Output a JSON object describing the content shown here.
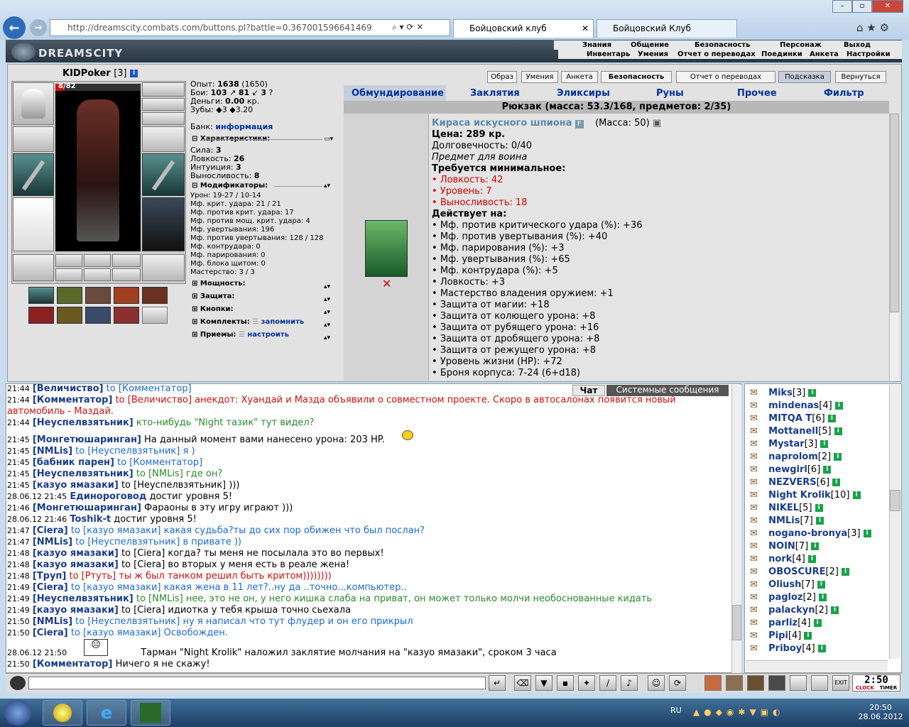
{
  "browser": {
    "url": "http://dreamscity.combats.com/buttons.pl?battle=0.367001596641469",
    "tabs": [
      "Бойцовский клуб",
      "Бойцовский Клуб"
    ],
    "win_buttons": [
      "–",
      "▫",
      "✕"
    ]
  },
  "game": {
    "logo": "DREAMSCITY",
    "menu_row1": [
      "Знания",
      "Общение",
      "Безопасность",
      "Персонаж",
      "Выход"
    ],
    "menu_row2": [
      "Инвентарь",
      "Умения",
      "Отчет о переводах",
      "Поединки",
      "Анкета",
      "Настройки"
    ]
  },
  "character": {
    "name": "KIDPoker",
    "level": "[3]",
    "hp": "8/82",
    "stats_top": [
      {
        "label": "Опыт:",
        "value": "1638",
        "extra": "(1650)"
      },
      {
        "label": "Бои:",
        "value": "103",
        "extra": "81",
        "extra2": "3"
      },
      {
        "label": "Деньги:",
        "value": "0.00",
        "extra": "кр."
      },
      {
        "label": "Зубы:",
        "value": "3",
        "extra": "3.20"
      }
    ],
    "bank_label": "Банк:",
    "bank_link": "информация",
    "characteristics_title": "Характеристики:",
    "characteristics": [
      {
        "label": "Сила:",
        "value": "3"
      },
      {
        "label": "Ловкость:",
        "value": "26"
      },
      {
        "label": "Интуиция:",
        "value": "3"
      },
      {
        "label": "Выносливость:",
        "value": "8"
      }
    ],
    "modifiers_title": "Модификаторы:",
    "modifiers": [
      "Урон: 19-27 / 10-14",
      "Мф. крит. удара: 21 / 21",
      "Мф. против крит. удара: 17",
      "Мф. против мощ. крит. удара: 4",
      "Мф. увертывания: 196",
      "Мф. против увертывания: 128 / 128",
      "Мф. контрудара: 0",
      "Мф. парирования: 0",
      "Мф. блока щитом: 0",
      "Мастерство: 3 / 3"
    ],
    "sections": [
      {
        "title": "Мощность:",
        "link": ""
      },
      {
        "title": "Защита:",
        "link": ""
      },
      {
        "title": "Кнопки:",
        "link": ""
      },
      {
        "title": "Комплекты:",
        "link": "запомнить"
      },
      {
        "title": "Приемы:",
        "link": "настроить"
      }
    ]
  },
  "top_buttons": [
    "Образ",
    "Умения",
    "Анкета",
    "Безопасность",
    "Отчет о переводах",
    "Подсказка",
    "Вернуться"
  ],
  "inventory": {
    "tabs": [
      "Обмундирование",
      "Заклятия",
      "Эликсиры",
      "Руны",
      "Прочее",
      "Фильтр"
    ],
    "backpack_title": "Рюкзак (масса: 53.3/168, предметов: 2/35)",
    "item": {
      "name": "Кираса искусного шпиона",
      "mass": "(Масса: 50)",
      "price": "Цена: 289 кр.",
      "durability": "Долговечность: 0/40",
      "for_class": "Предмет для воина",
      "req_title": "Требуется минимальное:",
      "requirements": [
        "Ловкость: 42",
        "Уровень: 7",
        "Выносливость: 18"
      ],
      "effects_title": "Действует на:",
      "effects": [
        "Мф. против критического удара (%): +36",
        "Мф. против увертывания (%): +40",
        "Мф. парирования (%): +3",
        "Мф. увертывания (%): +65",
        "Мф. контрудара (%): +5",
        "Ловкость: +3",
        "Мастерство владения оружием: +1",
        "Защита от магии: +18",
        "Защита от колющего урона: +8",
        "Защита от рубящего урона: +16",
        "Защита от дробящего урона: +8",
        "Защита от режущего урона: +8",
        "Уровень жизни (HP): +72",
        "Броня корпуса: 7-24 (6+d18)"
      ]
    }
  },
  "chat": {
    "tabs": [
      "Чат",
      "Системные сообщения"
    ],
    "lines": [
      {
        "time": "21:44",
        "nick": "[Величиство]",
        "to": "to [Комментатор]",
        "msg": "",
        "color": "#1a6ad8"
      },
      {
        "time": "21:44",
        "nick": "[Комментатор]",
        "to": "to [Величиство]",
        "msg": "анекдот: Хуандай и Мазда объявили о совместном проекте. Скоро в автосалонах появится новый",
        "color": "#d01010"
      },
      {
        "time": "",
        "nick": "",
        "to": "",
        "msg": "автомобиль - Маздай.",
        "color": "#d01010"
      },
      {
        "time": "21:44",
        "nick": "[Неуспелвзятьник]",
        "to": "",
        "msg": "кто-нибудь \"Night тазик\" тут видел?",
        "color": "#2a8a2a"
      },
      {
        "time": "21:45",
        "nick": "[Монгетюшаринган]",
        "to": "",
        "msg": "На данный момент вами нанесено урона: 203 HP.",
        "color": "#000000"
      },
      {
        "time": "21:45",
        "nick": "[NMLis]",
        "to": "to [Неуспелвзятьник]",
        "msg": "я )",
        "color": "#1a6ad8"
      },
      {
        "time": "21:45",
        "nick": "[бабник парен]",
        "to": "to [Комментатор]",
        "msg": "",
        "color": "#1a6ad8"
      },
      {
        "time": "21:45",
        "nick": "[Неуспелвзятьник]",
        "to": "to [NMLis]",
        "msg": "где он?",
        "color": "#2a8a2a"
      },
      {
        "time": "21:45",
        "nick": "[казуо ямазаки]",
        "to": "to [Неуспелвзятьник]",
        "msg": ")))",
        "color": "#000000"
      },
      {
        "time": "28.06.12 21:45",
        "nick": "Единороговод",
        "to": "",
        "msg": "достиг уровня 5!",
        "color": "#000000"
      },
      {
        "time": "21:46",
        "nick": "[Монгетюшаринган]",
        "to": "",
        "msg": "Фараоны в эту игру играют )))",
        "color": "#000000"
      },
      {
        "time": "28.06.12 21:46",
        "nick": "Toshik-t",
        "to": "",
        "msg": "достиг уровня 5!",
        "color": "#000000"
      },
      {
        "time": "21:47",
        "nick": "[Ciera]",
        "to": "to [казуо ямазаки]",
        "msg": "какая судьба?ты до сих пор обижен что был послан?",
        "color": "#1a6ad8"
      },
      {
        "time": "21:47",
        "nick": "[NMLis]",
        "to": "to [Неуспелвзятьник]",
        "msg": "в привате ))",
        "color": "#1a6ad8"
      },
      {
        "time": "21:48",
        "nick": "[казуо ямазаки]",
        "to": "to [Ciera]",
        "msg": "когда? ты меня не посылала это во первых!",
        "color": "#000000"
      },
      {
        "time": "21:48",
        "nick": "[казуо ямазаки]",
        "to": "to [Ciera]",
        "msg": "во вторых у меня есть в реале жена!",
        "color": "#000000"
      },
      {
        "time": "21:48",
        "nick": "[Труп]",
        "to": "to [Ртуть]",
        "msg": "ты ж был танком решил быть критом))))))))",
        "color": "#d01010"
      },
      {
        "time": "21:49",
        "nick": "[Ciera]",
        "to": "to [казуо ямазаки]",
        "msg": "какая жена в 11 лет?..ну да ..точно...компьютер..",
        "color": "#1a6ad8"
      },
      {
        "time": "21:49",
        "nick": "[Неуспелвзятьник]",
        "to": "to [NMLis]",
        "msg": "нее, это не он, у него кишка слаба на приват, он может только молчи необоснованные кидать",
        "color": "#2a8a2a"
      },
      {
        "time": "21:49",
        "nick": "[казуо ямазаки]",
        "to": "to [Ciera]",
        "msg": "идиотка у тебя крыша точно сьехала",
        "color": "#000000"
      },
      {
        "time": "21:50",
        "nick": "[NMLis]",
        "to": "to [Неуспелвзятьник]",
        "msg": "ну я написал что тут флудер и он его прикрыл",
        "color": "#1a6ad8"
      },
      {
        "time": "21:50",
        "nick": "[Ciera]",
        "to": "to [казуо ямазаки]",
        "msg": "Освобожден.",
        "color": "#1a6ad8"
      },
      {
        "time": "28.06.12 21:50",
        "nick": "",
        "to": "",
        "msg": "Тарман \"Night Krolik\" наложил заклятие молчания на \"казуо ямазаки\", сроком 3 часа",
        "color": "#000000"
      },
      {
        "time": "21:50",
        "nick": "[Комментатор]",
        "to": "",
        "msg": "Ничего я не скажу!",
        "color": "#000000"
      }
    ]
  },
  "users": [
    {
      "name": "Miks",
      "level": "[3]"
    },
    {
      "name": "mindenas",
      "level": "[4]"
    },
    {
      "name": "MITQA T",
      "level": "[6]"
    },
    {
      "name": "Mottanell",
      "level": "[5]"
    },
    {
      "name": "Mystar",
      "level": "[3]"
    },
    {
      "name": "naprolom",
      "level": "[2]"
    },
    {
      "name": "newgirl",
      "level": "[6]"
    },
    {
      "name": "NEZVERS",
      "level": "[6]"
    },
    {
      "name": "Night Krolik",
      "level": "[10]"
    },
    {
      "name": "NIKEL",
      "level": "[5]"
    },
    {
      "name": "NMLis",
      "level": "[7]"
    },
    {
      "name": "nogano-bronya",
      "level": "[3]"
    },
    {
      "name": "NOIN",
      "level": "[7]"
    },
    {
      "name": "nork",
      "level": "[4]"
    },
    {
      "name": "OBOSCURE",
      "level": "[2]"
    },
    {
      "name": "Oliush",
      "level": "[7]"
    },
    {
      "name": "pagloz",
      "level": "[2]"
    },
    {
      "name": "palackyn",
      "level": "[2]"
    },
    {
      "name": "parliz",
      "level": "[4]"
    },
    {
      "name": "Pipi",
      "level": "[4]"
    },
    {
      "name": "Priboy",
      "level": "[4]"
    }
  ],
  "clock": {
    "time": "2:50",
    "label1": "CLOCK",
    "label2": "TIMER"
  },
  "taskbar": {
    "lang": "RU",
    "time": "20:50",
    "date": "28.06.2012"
  },
  "colors": {
    "accent_blue": "#003399",
    "item_name": "#5a8aa8",
    "req_red": "#cc0000"
  }
}
